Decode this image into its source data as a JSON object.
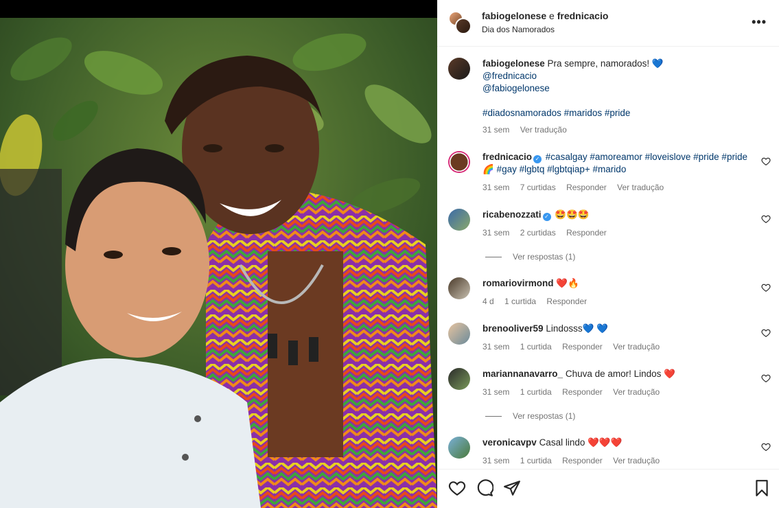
{
  "post": {
    "author1": "fabiogelonese",
    "joiner": "e",
    "author2": "frednicacio",
    "location": "Dia dos Namorados",
    "more_icon": "more-horizontal-icon"
  },
  "caption": {
    "user": "fabiogelonese",
    "text": "Pra sempre, namorados! 💙",
    "mention1": "@frednicacio",
    "mention2": "@fabiogelonese",
    "hashtags": [
      "#diadosnamorados",
      "#maridos",
      "#pride"
    ],
    "time": "31 sem",
    "translate": "Ver tradução"
  },
  "comments": [
    {
      "user": "frednicacio",
      "verified": true,
      "text_line1": "#casalgay #amoreamor #loveislove #pride #pride",
      "text_line2": "🌈 #gay #lgbtq #lgbtqiap+ #marido",
      "time": "31 sem",
      "likes": "7 curtidas",
      "reply": "Responder",
      "translate": "Ver tradução"
    },
    {
      "user": "ricabenozzati",
      "verified": true,
      "text": "🤩🤩🤩",
      "time": "31 sem",
      "likes": "2 curtidas",
      "reply": "Responder",
      "view_replies": "Ver respostas (1)"
    },
    {
      "user": "romariovirmond",
      "text": "❤️🔥",
      "time": "4 d",
      "likes": "1 curtida",
      "reply": "Responder"
    },
    {
      "user": "brenooliver59",
      "text": "Lindosss💙 💙",
      "time": "31 sem",
      "likes": "1 curtida",
      "reply": "Responder",
      "translate": "Ver tradução"
    },
    {
      "user": "mariannanavarro_",
      "text": "Chuva de amor! Lindos ❤️",
      "time": "31 sem",
      "likes": "1 curtida",
      "reply": "Responder",
      "translate": "Ver tradução",
      "view_replies": "Ver respostas (1)"
    },
    {
      "user": "veronicavpv",
      "text": "Casal lindo ❤️❤️❤️",
      "time": "31 sem",
      "likes": "1 curtida",
      "reply": "Responder",
      "translate": "Ver tradução"
    }
  ],
  "actions": {
    "like_icon": "heart-outline-icon",
    "comment_icon": "comment-bubble-icon",
    "share_icon": "paper-plane-icon",
    "save_icon": "bookmark-icon"
  },
  "colors": {
    "link": "#00376b",
    "muted": "#737373",
    "text": "#262626",
    "verified": "#3897f0"
  }
}
